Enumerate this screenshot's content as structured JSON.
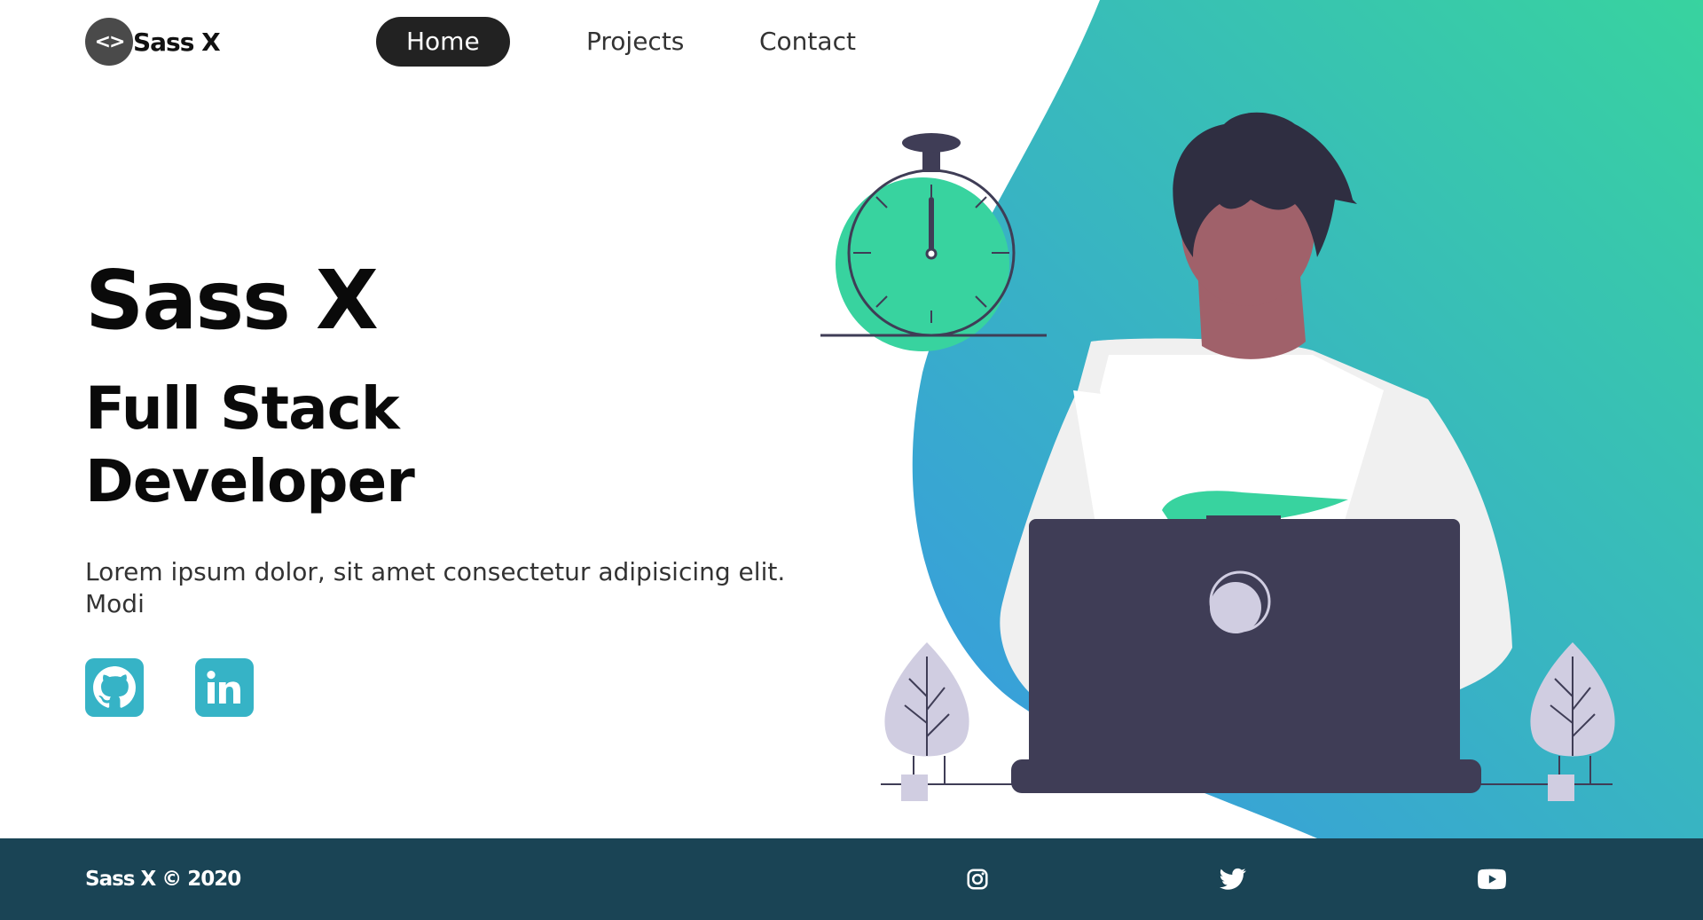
{
  "colors": {
    "accent_green": "#38d39f",
    "accent_blue": "#38a1d8",
    "dark": "#222222",
    "laptop": "#3f3d56",
    "footer_bg": "#1a4455",
    "social_bg": "#36b3c6",
    "skin": "#a0616a"
  },
  "brand": {
    "logo_symbol": "<>",
    "name": "Sass X"
  },
  "nav": {
    "links": [
      {
        "label": "Home",
        "active": true
      },
      {
        "label": "Projects",
        "active": false
      },
      {
        "label": "Contact",
        "active": false
      }
    ]
  },
  "hero": {
    "title": "Sass X",
    "subtitle_line1": "Full Stack",
    "subtitle_line2": "Developer",
    "description": "Lorem ipsum dolor, sit amet consectetur adipisicing elit. Modi",
    "social": [
      {
        "icon": "github-icon"
      },
      {
        "icon": "linkedin-icon"
      }
    ]
  },
  "illustration": {
    "icons": [
      "stopwatch-icon",
      "person-icon",
      "laptop-icon",
      "plant-icon",
      "plant-icon"
    ]
  },
  "footer": {
    "copyright": "Sass X © 2020",
    "icons": [
      "instagram-icon",
      "twitter-icon",
      "youtube-icon"
    ]
  }
}
